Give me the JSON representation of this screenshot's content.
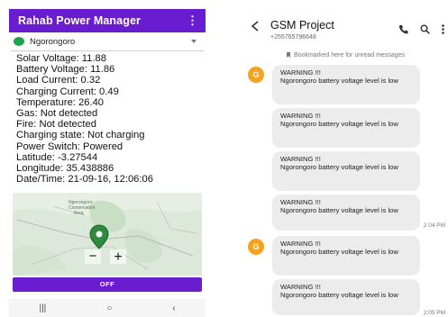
{
  "left_app": {
    "title": "Rahab Power Manager",
    "menu_icon": "⋮",
    "site": {
      "name": "Ngorongoro",
      "icon": "site-icon",
      "color": "#23a04a"
    },
    "readings": [
      "Solar Voltage: 11.88",
      "Battery Voltage: 11.86",
      "Load Current: 0.32",
      "Charging Current: 0.49",
      "Temperature: 26.40",
      "Gas: Not detected",
      "Fire: Not detected",
      "Charging state: Not charging",
      "Power Switch: Powered",
      "Latitude: -3.27544",
      "Longitude: 35.438886",
      "Date/Time: 21-09-16, 12:06:06"
    ],
    "map": {
      "label_line1": "Ngorongoro",
      "label_line2": "Conservation",
      "label_line3": "Area",
      "zoom_out": "−",
      "zoom_in": "+"
    },
    "off_button": "OFF",
    "nav": {
      "recent": "|||",
      "home": "○",
      "back": "‹"
    },
    "accent": "#6a1cd1"
  },
  "right_app": {
    "contact_name": "GSM Project",
    "contact_number": "+255765796648",
    "back_icon": "back-arrow-icon",
    "bookmark_text": "Bookmarked here for unread messages",
    "avatar_letter": "G",
    "avatar_color": "#f5a31e",
    "messages": [
      "WARNING !!!\nNgorongoro battery voltage level is low",
      "WARNING !!!\nNgorongoro battery voltage level is low",
      "WARNING !!!\nNgorongoro battery voltage level is low",
      "WARNING !!!\nNgorongoro battery voltage level is low",
      "WARNING !!!\nNgorongoro battery voltage level is low",
      "WARNING !!!\nNgorongoro battery voltage level is low"
    ],
    "timestamps": [
      "2:04 PM",
      "2:05 PM"
    ]
  }
}
